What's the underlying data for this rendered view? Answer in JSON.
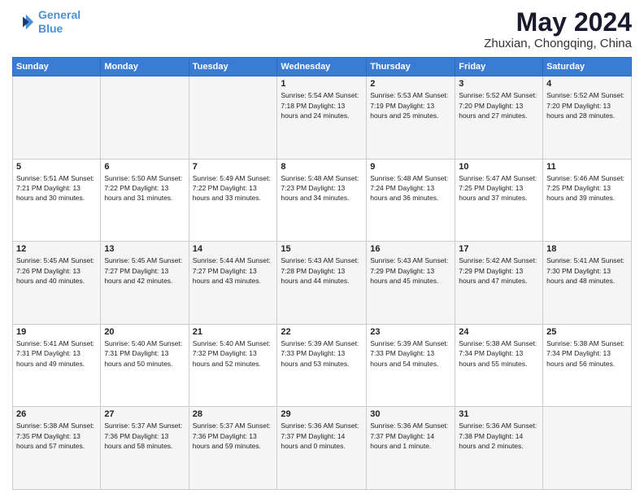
{
  "logo": {
    "line1": "General",
    "line2": "Blue"
  },
  "title": "May 2024",
  "location": "Zhuxian, Chongqing, China",
  "days_header": [
    "Sunday",
    "Monday",
    "Tuesday",
    "Wednesday",
    "Thursday",
    "Friday",
    "Saturday"
  ],
  "weeks": [
    [
      {
        "day": "",
        "info": ""
      },
      {
        "day": "",
        "info": ""
      },
      {
        "day": "",
        "info": ""
      },
      {
        "day": "1",
        "info": "Sunrise: 5:54 AM\nSunset: 7:18 PM\nDaylight: 13 hours\nand 24 minutes."
      },
      {
        "day": "2",
        "info": "Sunrise: 5:53 AM\nSunset: 7:19 PM\nDaylight: 13 hours\nand 25 minutes."
      },
      {
        "day": "3",
        "info": "Sunrise: 5:52 AM\nSunset: 7:20 PM\nDaylight: 13 hours\nand 27 minutes."
      },
      {
        "day": "4",
        "info": "Sunrise: 5:52 AM\nSunset: 7:20 PM\nDaylight: 13 hours\nand 28 minutes."
      }
    ],
    [
      {
        "day": "5",
        "info": "Sunrise: 5:51 AM\nSunset: 7:21 PM\nDaylight: 13 hours\nand 30 minutes."
      },
      {
        "day": "6",
        "info": "Sunrise: 5:50 AM\nSunset: 7:22 PM\nDaylight: 13 hours\nand 31 minutes."
      },
      {
        "day": "7",
        "info": "Sunrise: 5:49 AM\nSunset: 7:22 PM\nDaylight: 13 hours\nand 33 minutes."
      },
      {
        "day": "8",
        "info": "Sunrise: 5:48 AM\nSunset: 7:23 PM\nDaylight: 13 hours\nand 34 minutes."
      },
      {
        "day": "9",
        "info": "Sunrise: 5:48 AM\nSunset: 7:24 PM\nDaylight: 13 hours\nand 36 minutes."
      },
      {
        "day": "10",
        "info": "Sunrise: 5:47 AM\nSunset: 7:25 PM\nDaylight: 13 hours\nand 37 minutes."
      },
      {
        "day": "11",
        "info": "Sunrise: 5:46 AM\nSunset: 7:25 PM\nDaylight: 13 hours\nand 39 minutes."
      }
    ],
    [
      {
        "day": "12",
        "info": "Sunrise: 5:45 AM\nSunset: 7:26 PM\nDaylight: 13 hours\nand 40 minutes."
      },
      {
        "day": "13",
        "info": "Sunrise: 5:45 AM\nSunset: 7:27 PM\nDaylight: 13 hours\nand 42 minutes."
      },
      {
        "day": "14",
        "info": "Sunrise: 5:44 AM\nSunset: 7:27 PM\nDaylight: 13 hours\nand 43 minutes."
      },
      {
        "day": "15",
        "info": "Sunrise: 5:43 AM\nSunset: 7:28 PM\nDaylight: 13 hours\nand 44 minutes."
      },
      {
        "day": "16",
        "info": "Sunrise: 5:43 AM\nSunset: 7:29 PM\nDaylight: 13 hours\nand 45 minutes."
      },
      {
        "day": "17",
        "info": "Sunrise: 5:42 AM\nSunset: 7:29 PM\nDaylight: 13 hours\nand 47 minutes."
      },
      {
        "day": "18",
        "info": "Sunrise: 5:41 AM\nSunset: 7:30 PM\nDaylight: 13 hours\nand 48 minutes."
      }
    ],
    [
      {
        "day": "19",
        "info": "Sunrise: 5:41 AM\nSunset: 7:31 PM\nDaylight: 13 hours\nand 49 minutes."
      },
      {
        "day": "20",
        "info": "Sunrise: 5:40 AM\nSunset: 7:31 PM\nDaylight: 13 hours\nand 50 minutes."
      },
      {
        "day": "21",
        "info": "Sunrise: 5:40 AM\nSunset: 7:32 PM\nDaylight: 13 hours\nand 52 minutes."
      },
      {
        "day": "22",
        "info": "Sunrise: 5:39 AM\nSunset: 7:33 PM\nDaylight: 13 hours\nand 53 minutes."
      },
      {
        "day": "23",
        "info": "Sunrise: 5:39 AM\nSunset: 7:33 PM\nDaylight: 13 hours\nand 54 minutes."
      },
      {
        "day": "24",
        "info": "Sunrise: 5:38 AM\nSunset: 7:34 PM\nDaylight: 13 hours\nand 55 minutes."
      },
      {
        "day": "25",
        "info": "Sunrise: 5:38 AM\nSunset: 7:34 PM\nDaylight: 13 hours\nand 56 minutes."
      }
    ],
    [
      {
        "day": "26",
        "info": "Sunrise: 5:38 AM\nSunset: 7:35 PM\nDaylight: 13 hours\nand 57 minutes."
      },
      {
        "day": "27",
        "info": "Sunrise: 5:37 AM\nSunset: 7:36 PM\nDaylight: 13 hours\nand 58 minutes."
      },
      {
        "day": "28",
        "info": "Sunrise: 5:37 AM\nSunset: 7:36 PM\nDaylight: 13 hours\nand 59 minutes."
      },
      {
        "day": "29",
        "info": "Sunrise: 5:36 AM\nSunset: 7:37 PM\nDaylight: 14 hours\nand 0 minutes."
      },
      {
        "day": "30",
        "info": "Sunrise: 5:36 AM\nSunset: 7:37 PM\nDaylight: 14 hours\nand 1 minute."
      },
      {
        "day": "31",
        "info": "Sunrise: 5:36 AM\nSunset: 7:38 PM\nDaylight: 14 hours\nand 2 minutes."
      },
      {
        "day": "",
        "info": ""
      }
    ]
  ]
}
